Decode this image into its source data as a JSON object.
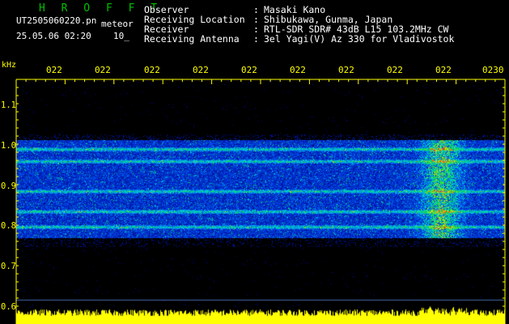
{
  "header": {
    "app_title": "H R O F F T",
    "file_name": "UT2505060220.pn",
    "file_suffix": "meteor",
    "datetime": "25.05.06 02:20",
    "interval": "10_",
    "info_rows": [
      {
        "key": "Observer",
        "value": "Masaki Kano"
      },
      {
        "key": "Receiving Location",
        "value": "Shibukawa, Gunma, Japan"
      },
      {
        "key": "Receiver",
        "value": "RTL-SDR SDR# 43dB L15 103.2MHz CW"
      },
      {
        "key": "Receiving Antenna",
        "value": "3el Yagi(V) Az 330 for Vladivostok"
      }
    ],
    "separator": ":"
  },
  "axes": {
    "y_label": "kHz",
    "y_ticks": [
      "1.1",
      "1.0",
      "0.9",
      "0.8",
      "0.7",
      "0.6"
    ],
    "x_ticks": [
      "022",
      "022",
      "022",
      "022",
      "022",
      "022",
      "022",
      "022",
      "022",
      "0230"
    ]
  },
  "colors": {
    "background": "#000000",
    "title_green": "#00c000",
    "axis_yellow": "#ffff00",
    "text_white": "#ffffff",
    "spectrogram_base": "#001a8c",
    "signal_lines": "#ff3030"
  }
}
